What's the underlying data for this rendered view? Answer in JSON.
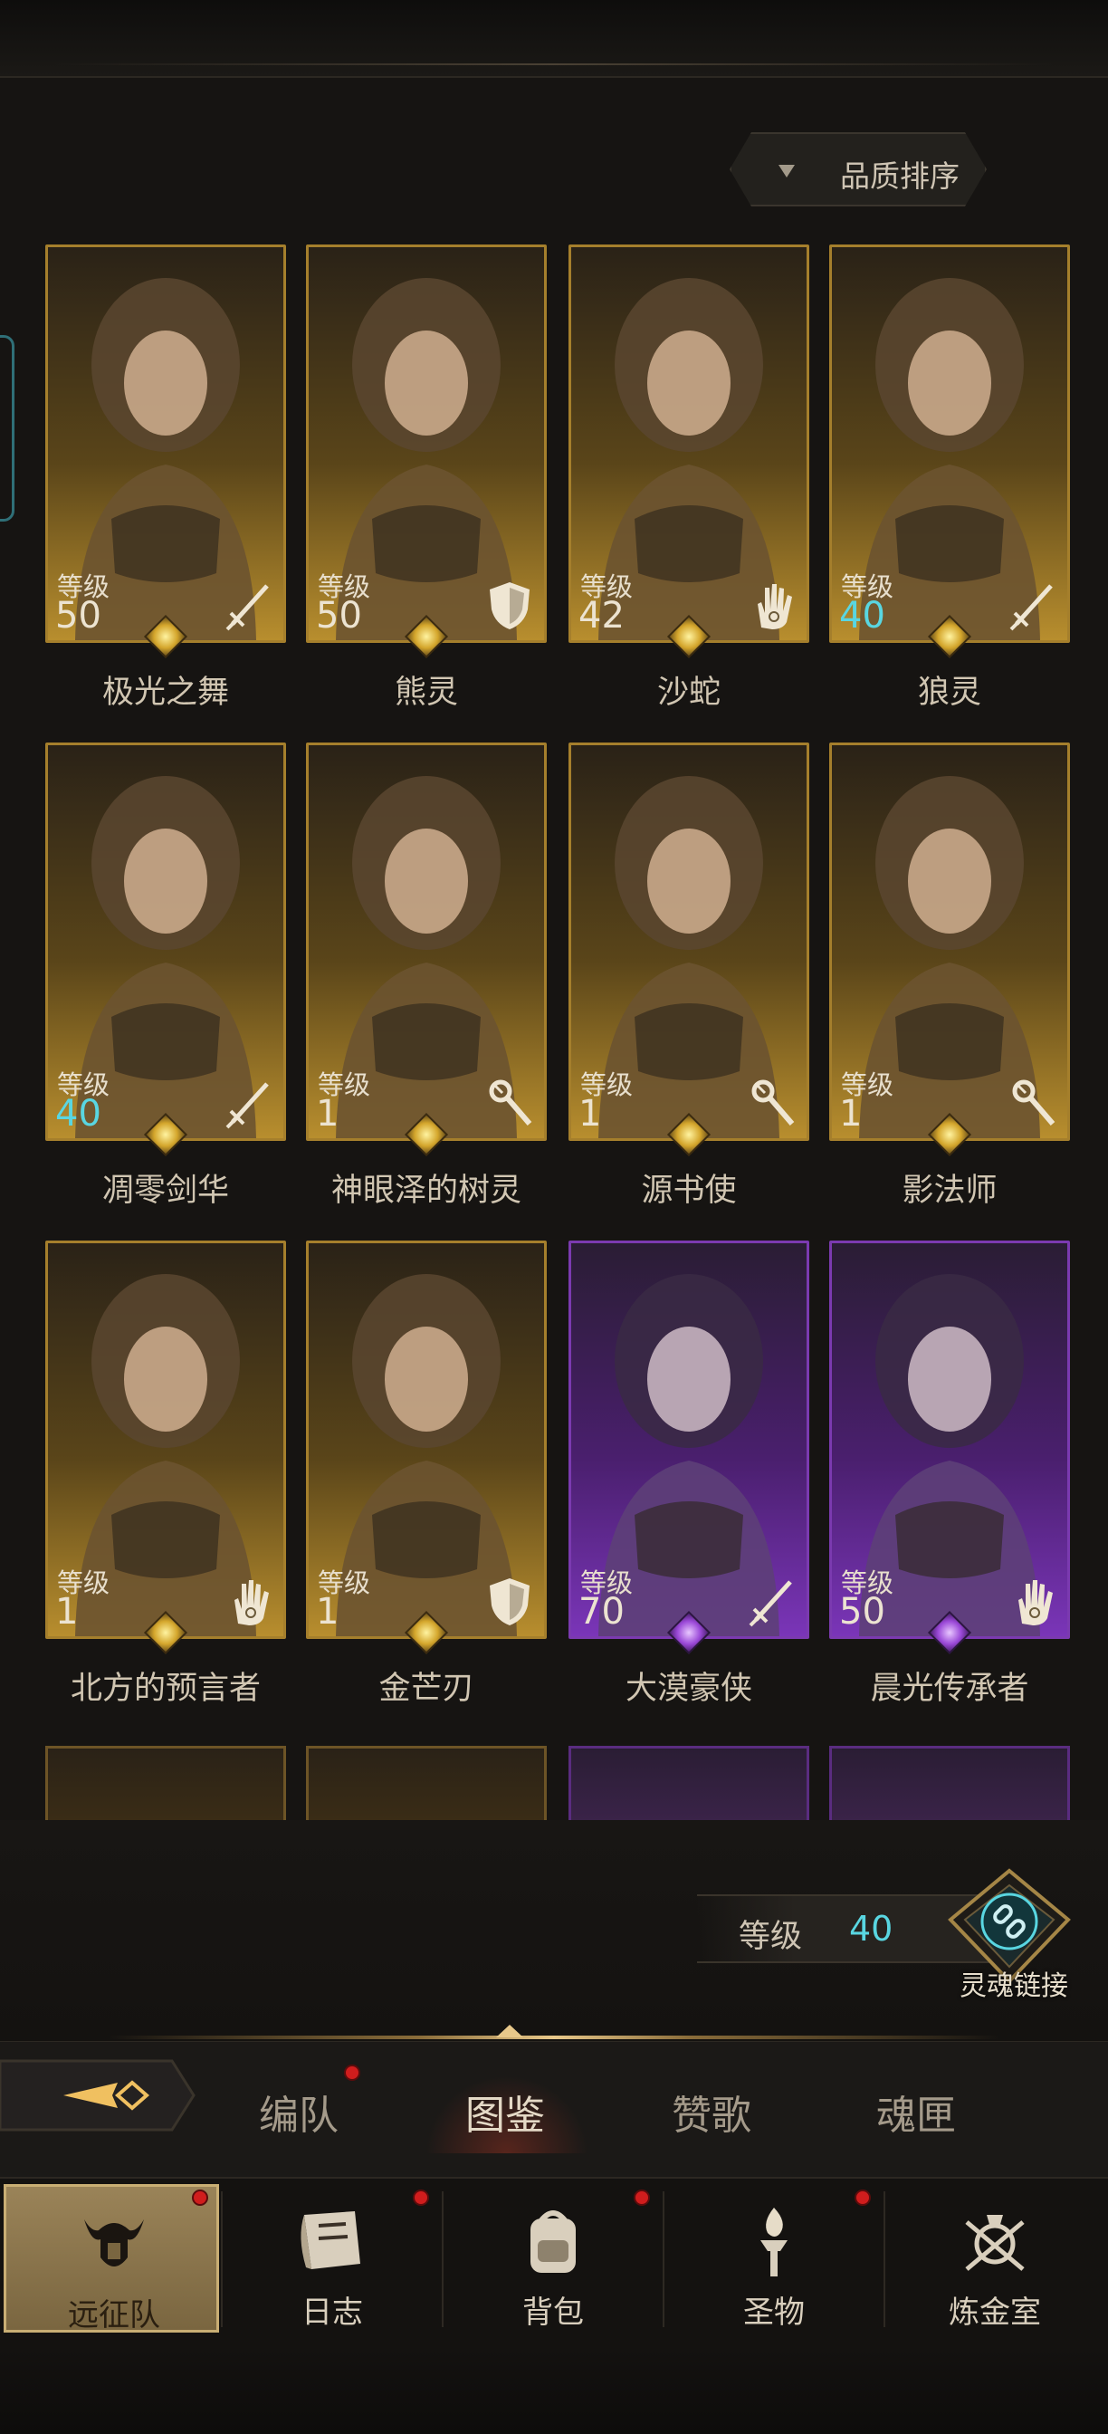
{
  "sort": {
    "label": "品质排序"
  },
  "heroes": [
    {
      "name": "极光之舞",
      "level_label": "等级",
      "level": "50",
      "level_blue": false,
      "role": "sword-icon",
      "rarity": "gold"
    },
    {
      "name": "熊灵",
      "level_label": "等级",
      "level": "50",
      "level_blue": false,
      "role": "shield-icon",
      "rarity": "gold"
    },
    {
      "name": "沙蛇",
      "level_label": "等级",
      "level": "42",
      "level_blue": false,
      "role": "hand-icon",
      "rarity": "gold"
    },
    {
      "name": "狼灵",
      "level_label": "等级",
      "level": "40",
      "level_blue": true,
      "role": "sword-icon",
      "rarity": "gold"
    },
    {
      "name": "凋零剑华",
      "level_label": "等级",
      "level": "40",
      "level_blue": true,
      "role": "sword-icon",
      "rarity": "gold"
    },
    {
      "name": "神眼泽的树灵",
      "level_label": "等级",
      "level": "1",
      "level_blue": false,
      "role": "staff-icon",
      "rarity": "gold"
    },
    {
      "name": "源书使",
      "level_label": "等级",
      "level": "1",
      "level_blue": false,
      "role": "staff-icon",
      "rarity": "gold"
    },
    {
      "name": "影法师",
      "level_label": "等级",
      "level": "1",
      "level_blue": false,
      "role": "staff-icon",
      "rarity": "gold"
    },
    {
      "name": "北方的预言者",
      "level_label": "等级",
      "level": "1",
      "level_blue": false,
      "role": "hand-icon",
      "rarity": "gold"
    },
    {
      "name": "金芒刃",
      "level_label": "等级",
      "level": "1",
      "level_blue": false,
      "role": "shield-icon",
      "rarity": "gold"
    },
    {
      "name": "大漠豪侠",
      "level_label": "等级",
      "level": "70",
      "level_blue": false,
      "role": "sword-icon",
      "rarity": "purple"
    },
    {
      "name": "晨光传承者",
      "level_label": "等级",
      "level": "50",
      "level_blue": false,
      "role": "hand-icon",
      "rarity": "purple"
    }
  ],
  "soul_link": {
    "level_label": "等级",
    "level": "40",
    "button_label": "灵魂链接"
  },
  "tabs": [
    {
      "label": "编队",
      "dot": true,
      "active": false
    },
    {
      "label": "图鉴",
      "dot": false,
      "active": true
    },
    {
      "label": "赞歌",
      "dot": false,
      "active": false
    },
    {
      "label": "魂匣",
      "dot": false,
      "active": false
    }
  ],
  "nav": [
    {
      "label": "远征队",
      "icon": "helmet-icon",
      "dot": true,
      "active": true
    },
    {
      "label": "日志",
      "icon": "scroll-icon",
      "dot": true,
      "active": false
    },
    {
      "label": "背包",
      "icon": "backpack-icon",
      "dot": true,
      "active": false
    },
    {
      "label": "圣物",
      "icon": "torch-icon",
      "dot": true,
      "active": false
    },
    {
      "label": "炼金室",
      "icon": "alchemy-icon",
      "dot": false,
      "active": false
    }
  ],
  "colors": {
    "gold_frame": "#a57f2c",
    "purple_frame": "#7b3ab0",
    "level_blue": "#59d6e1",
    "dot_red": "#d01d1d"
  }
}
